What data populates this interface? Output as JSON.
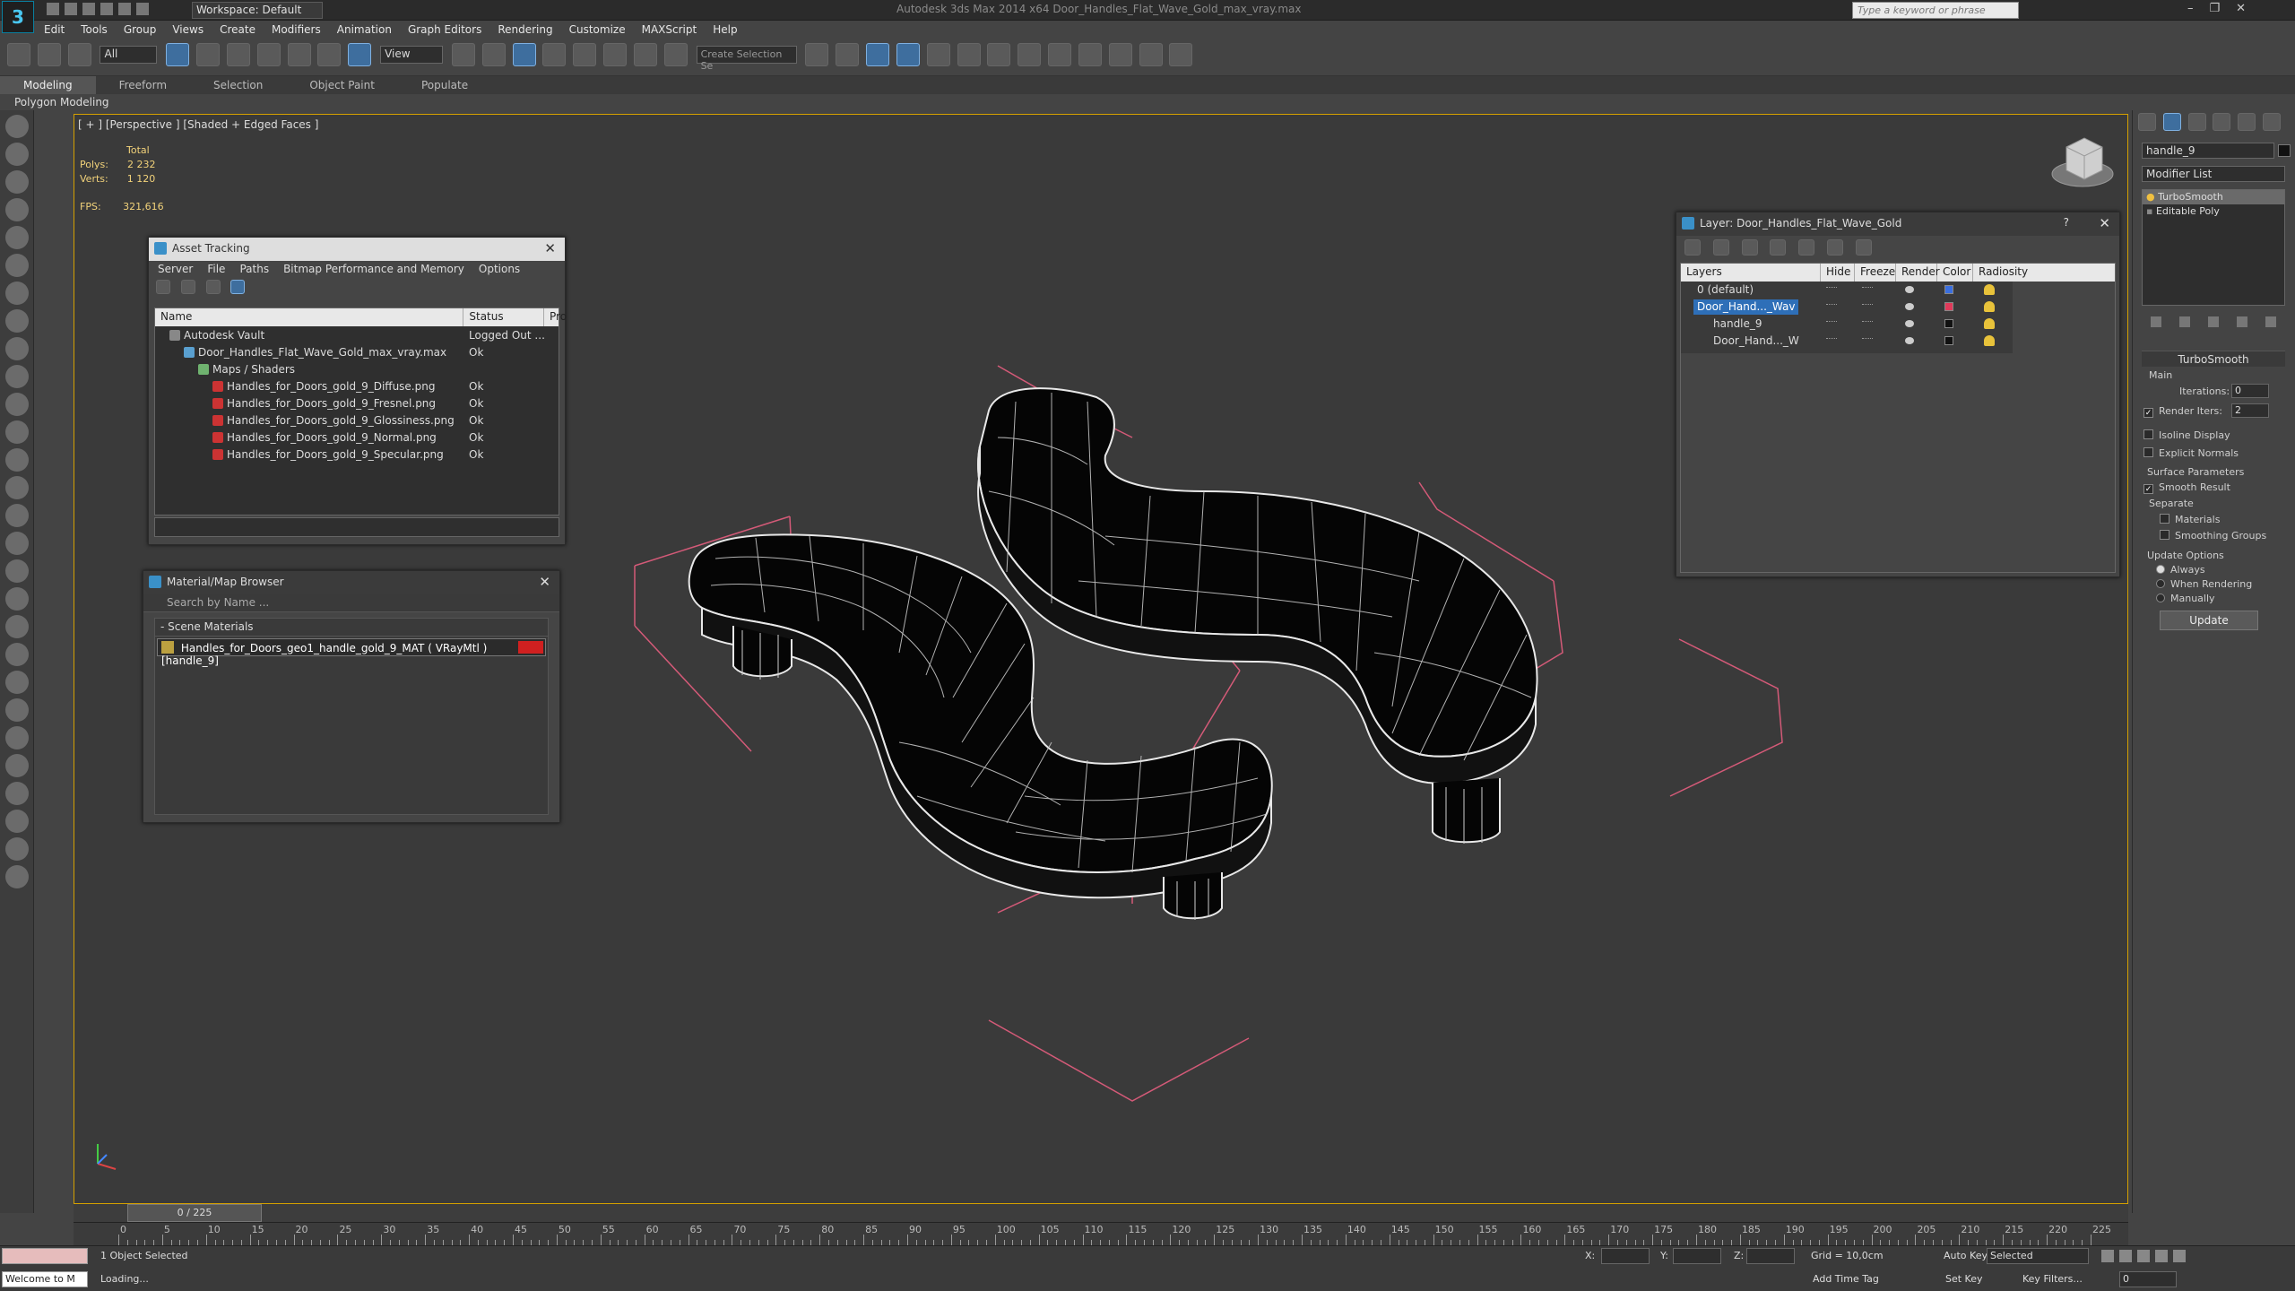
{
  "app": {
    "title": "Autodesk 3ds Max 2014 x64    Door_Handles_Flat_Wave_Gold_max_vray.max",
    "logo": "3",
    "workspace": "Workspace: Default",
    "search_placeholder": "Type a keyword or phrase"
  },
  "menu": [
    "Edit",
    "Tools",
    "Group",
    "Views",
    "Create",
    "Modifiers",
    "Animation",
    "Graph Editors",
    "Rendering",
    "Customize",
    "MAXScript",
    "Help"
  ],
  "toolbar": {
    "selection_filter": "All",
    "ref_coord": "View",
    "selection_set_placeholder": "Create Selection Se"
  },
  "ribbon": {
    "tabs": [
      "Modeling",
      "Freeform",
      "Selection",
      "Object Paint",
      "Populate"
    ],
    "active": "Modeling",
    "sub": "Polygon Modeling"
  },
  "viewport": {
    "label": "[ + ] [Perspective ] [Shaded + Edged Faces ]",
    "stats_header": "Total",
    "polys_label": "Polys:",
    "polys": "2 232",
    "verts_label": "Verts:",
    "verts": "1 120",
    "fps_label": "FPS:",
    "fps": "321,616"
  },
  "asset_tracking": {
    "title": "Asset Tracking",
    "menu": [
      "Server",
      "File",
      "Paths",
      "Bitmap Performance and Memory",
      "Options"
    ],
    "columns": [
      "Name",
      "Status",
      "Pro"
    ],
    "rows": [
      {
        "name": "Autodesk Vault",
        "status": "Logged Out ...",
        "indent": 1,
        "type": "vault"
      },
      {
        "name": "Door_Handles_Flat_Wave_Gold_max_vray.max",
        "status": "Ok",
        "indent": 2,
        "type": "max"
      },
      {
        "name": "Maps / Shaders",
        "status": "",
        "indent": 3,
        "type": "map"
      },
      {
        "name": "Handles_for_Doors_gold_9_Diffuse.png",
        "status": "Ok",
        "indent": 4,
        "type": "png"
      },
      {
        "name": "Handles_for_Doors_gold_9_Fresnel.png",
        "status": "Ok",
        "indent": 4,
        "type": "png"
      },
      {
        "name": "Handles_for_Doors_gold_9_Glossiness.png",
        "status": "Ok",
        "indent": 4,
        "type": "png"
      },
      {
        "name": "Handles_for_Doors_gold_9_Normal.png",
        "status": "Ok",
        "indent": 4,
        "type": "png"
      },
      {
        "name": "Handles_for_Doors_gold_9_Specular.png",
        "status": "Ok",
        "indent": 4,
        "type": "png"
      }
    ]
  },
  "material_browser": {
    "title": "Material/Map Browser",
    "search": "Search by Name ...",
    "group": "- Scene Materials",
    "item": "Handles_for_Doors_geo1_handle_gold_9_MAT ( VRayMtl ) [handle_9]"
  },
  "layers": {
    "title": "Layer: Door_Handles_Flat_Wave_Gold",
    "help": "?",
    "columns": [
      "Layers",
      "Hide",
      "Freeze",
      "Render",
      "Color",
      "Radiosity"
    ],
    "rows": [
      {
        "name": "0 (default)",
        "indent": 0,
        "color": "#3a6fe0",
        "selected": false
      },
      {
        "name": "Door_Hand..._Wav",
        "indent": 0,
        "color": "#e03a5a",
        "selected": true
      },
      {
        "name": "handle_9",
        "indent": 1,
        "color": "#111111",
        "selected": false
      },
      {
        "name": "Door_Hand..._W",
        "indent": 1,
        "color": "#111111",
        "selected": false
      }
    ]
  },
  "command_panel": {
    "object_name": "handle_9",
    "modifier_list": "Modifier List",
    "stack": [
      "TurboSmooth",
      "Editable Poly"
    ],
    "rollout": "TurboSmooth",
    "main_label": "Main",
    "iterations_label": "Iterations:",
    "iterations": "0",
    "render_iters_label": "Render Iters:",
    "render_iters": "2",
    "isoline": "Isoline Display",
    "explicit_normals": "Explicit Normals",
    "surface_params": "Surface Parameters",
    "smooth_result": "Smooth Result",
    "separate": "Separate",
    "materials": "Materials",
    "smoothing_groups": "Smoothing Groups",
    "update_options": "Update Options",
    "always": "Always",
    "when_rendering": "When Rendering",
    "manually": "Manually",
    "update_btn": "Update"
  },
  "timeline": {
    "frame": "0 / 225",
    "ticks": [
      "0",
      "5",
      "10",
      "15",
      "20",
      "25",
      "30",
      "35",
      "40",
      "45",
      "50",
      "55",
      "60",
      "65",
      "70",
      "75",
      "80",
      "85",
      "90",
      "95",
      "100",
      "105",
      "110",
      "115",
      "120",
      "125",
      "130",
      "135",
      "140",
      "145",
      "150",
      "155",
      "160",
      "165",
      "170",
      "175",
      "180",
      "185",
      "190",
      "195",
      "200",
      "205",
      "210",
      "215",
      "220",
      "225"
    ]
  },
  "status": {
    "welcome": "Welcome to M",
    "selected": "1 Object Selected",
    "loading": "Loading...",
    "x_label": "X:",
    "y_label": "Y:",
    "z_label": "Z:",
    "grid": "Grid = 10,0cm",
    "add_time_tag": "Add Time Tag",
    "auto_key": "Auto Key",
    "set_key": "Set Key",
    "selected_dd": "Selected",
    "key_filters": "Key Filters...",
    "frame_value": "0"
  }
}
